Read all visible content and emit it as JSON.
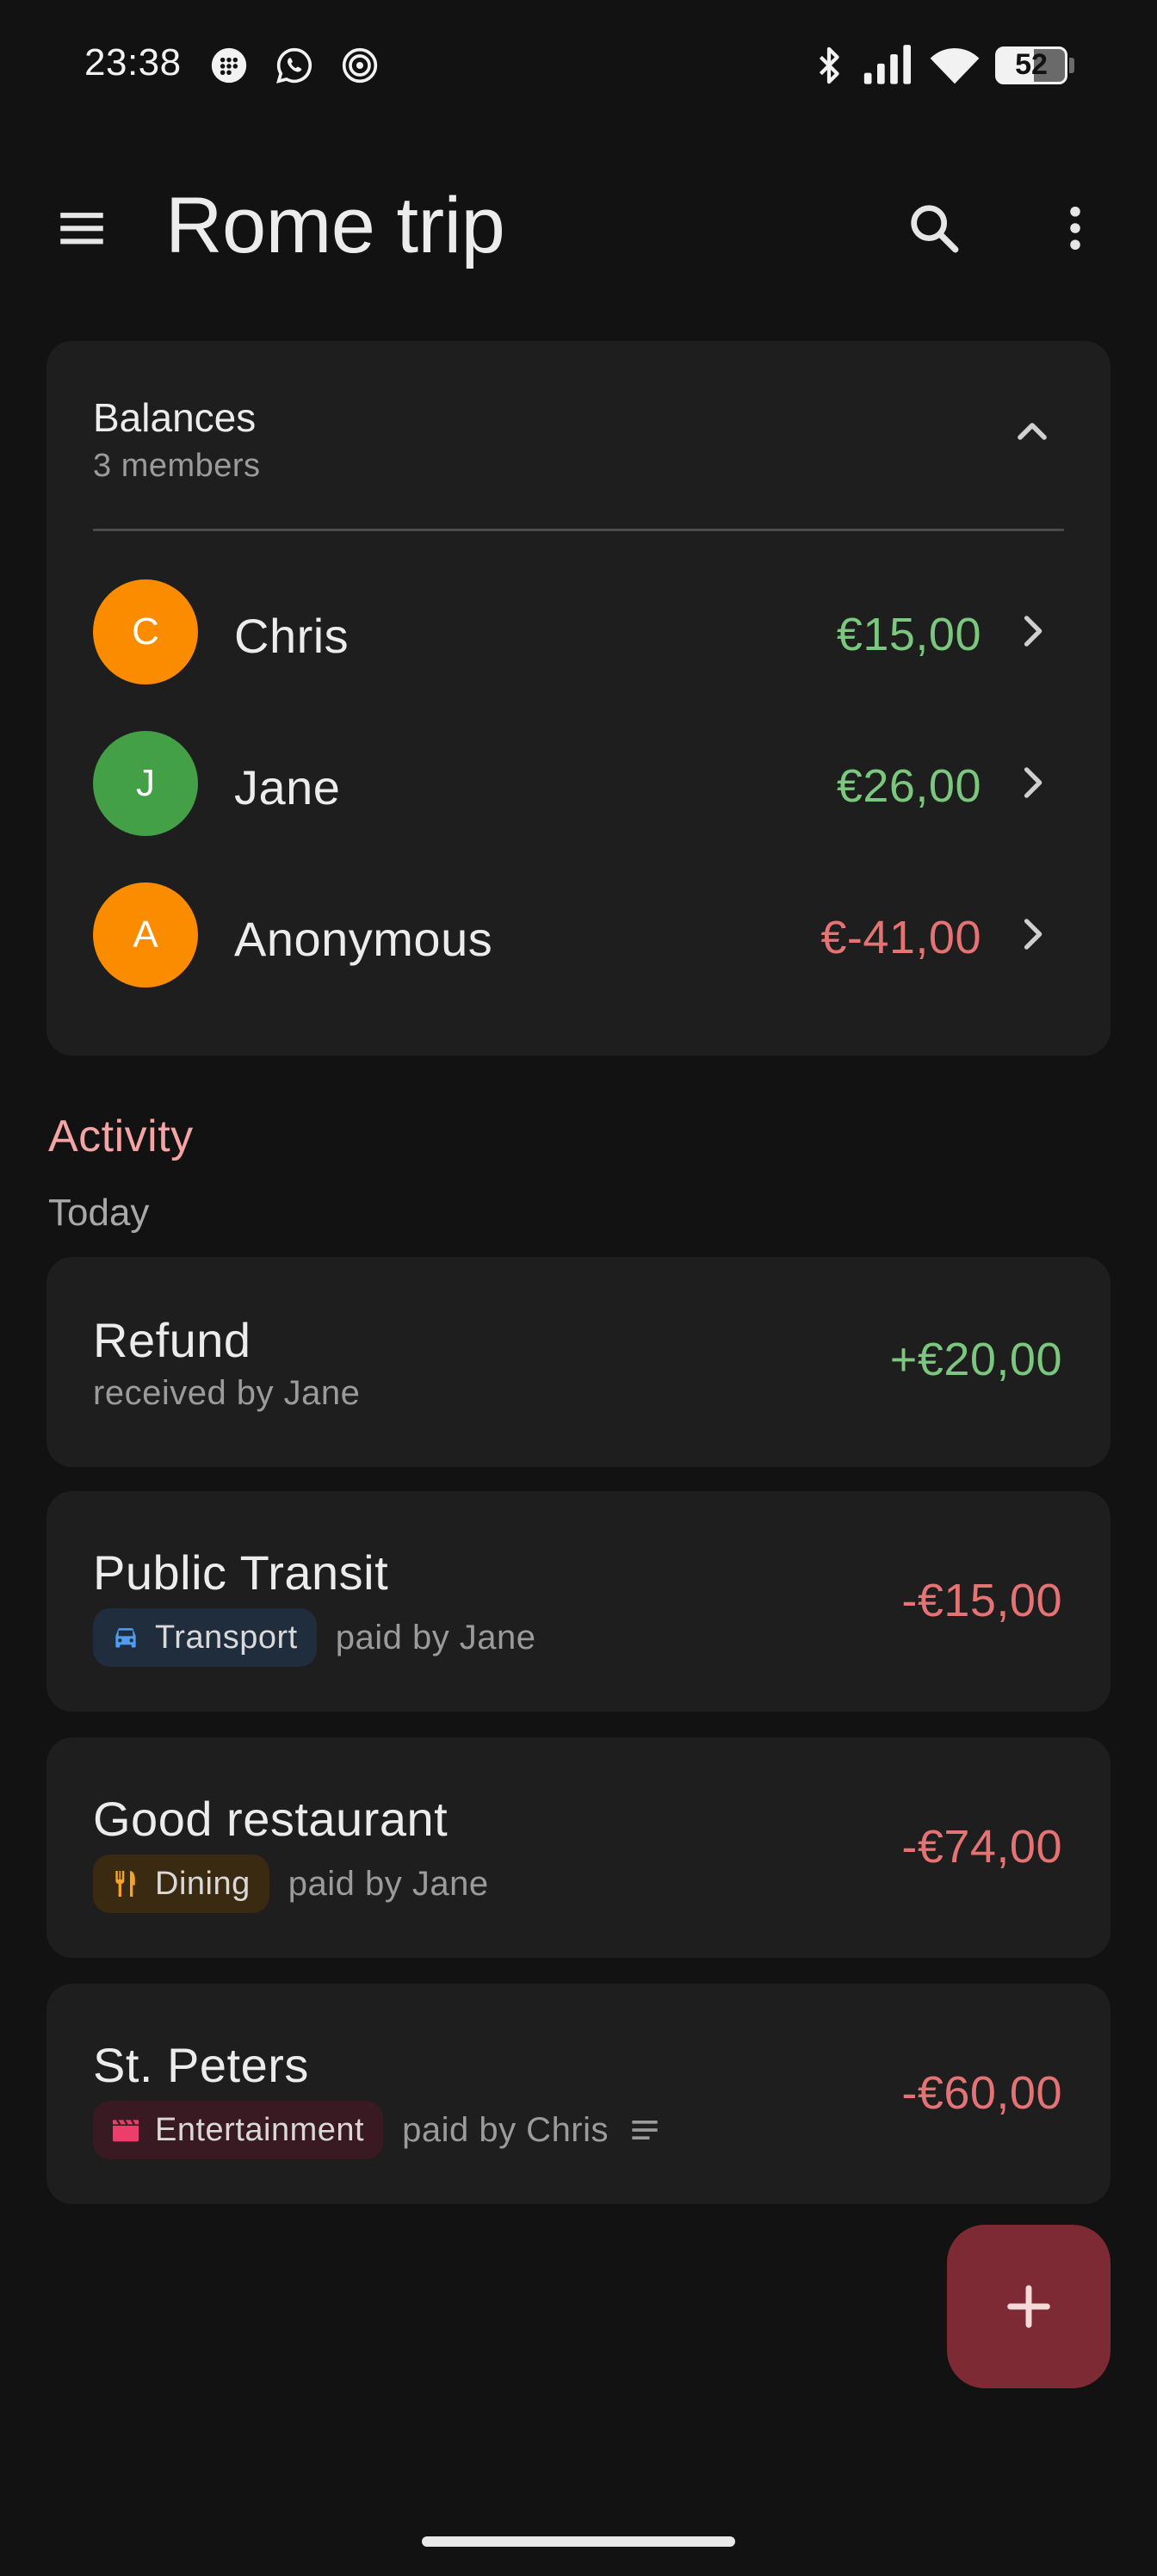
{
  "status_bar": {
    "time": "23:38",
    "notifications": [
      "chat-icon",
      "whatsapp-icon",
      "target-icon"
    ],
    "battery": "52"
  },
  "app_bar": {
    "title": "Rome trip"
  },
  "balances": {
    "title": "Balances",
    "subtitle": "3 members",
    "members": [
      {
        "initial": "C",
        "name": "Chris",
        "amount": "€15,00",
        "avatar_color": "#fb8c00",
        "amount_color": "#7bc77e"
      },
      {
        "initial": "J",
        "name": "Jane",
        "amount": "€26,00",
        "avatar_color": "#43a047",
        "amount_color": "#7bc77e"
      },
      {
        "initial": "A",
        "name": "Anonymous",
        "amount": "€-41,00",
        "avatar_color": "#fb8c00",
        "amount_color": "#e57373"
      }
    ]
  },
  "activity": {
    "heading": "Activity",
    "group_label": "Today",
    "transactions": [
      {
        "title": "Refund",
        "subtitle": "received by Jane",
        "amount": "+€20,00"
      },
      {
        "title": "Public Transit",
        "category": "Transport",
        "category_icon": "car-icon",
        "paid_by": "paid by Jane",
        "amount": "-€15,00"
      },
      {
        "title": "Good restaurant",
        "category": "Dining",
        "category_icon": "fork-knife-icon",
        "paid_by": "paid by Jane",
        "amount": "-€74,00"
      },
      {
        "title": "St. Peters",
        "category": "Entertainment",
        "category_icon": "clapperboard-icon",
        "paid_by": "paid by Chris",
        "amount": "-€60,00",
        "has_notes": true
      }
    ]
  },
  "colors": {
    "background": "#121212",
    "card": "#1e1e1f",
    "positive": "#7bc77e",
    "negative": "#e57373",
    "accent": "#f5a3a3",
    "fab": "#7d2a34"
  }
}
